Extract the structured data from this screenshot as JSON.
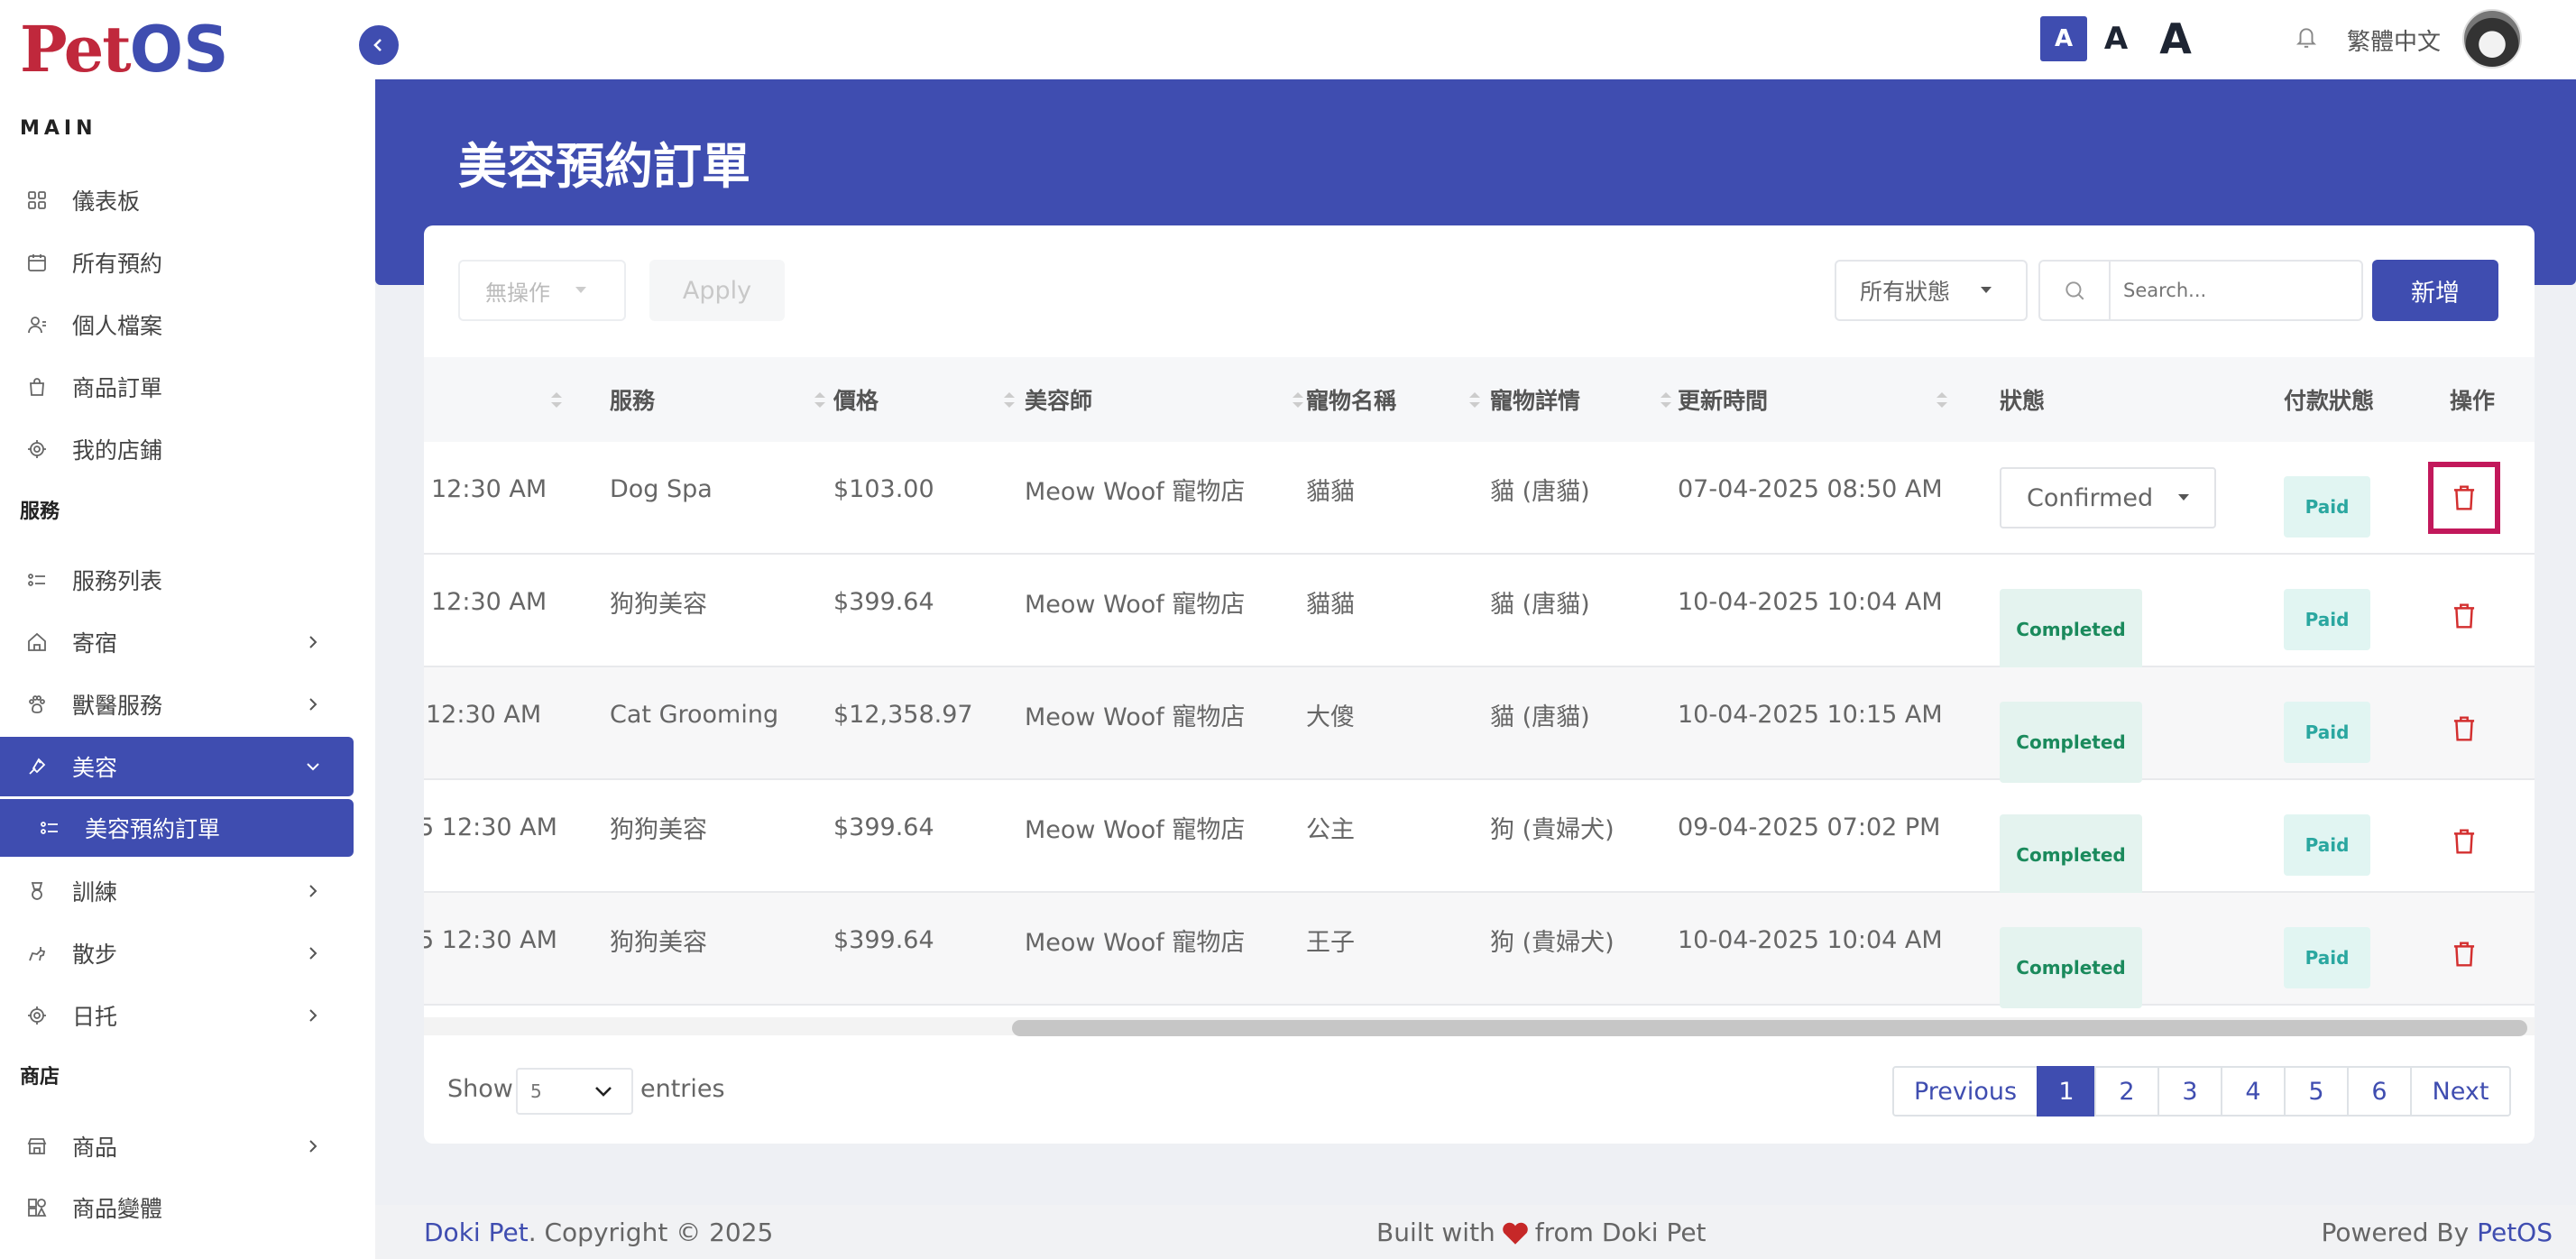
{
  "brand": {
    "logo_pet": "Pet",
    "logo_os": "OS"
  },
  "sidebar": {
    "section_main": "MAIN",
    "section_service": "服務",
    "section_shop": "商店",
    "items": [
      {
        "label": "儀表板"
      },
      {
        "label": "所有預約"
      },
      {
        "label": "個人檔案"
      },
      {
        "label": "商品訂單"
      },
      {
        "label": "我的店鋪"
      },
      {
        "label": "服務列表"
      },
      {
        "label": "寄宿"
      },
      {
        "label": "獸醫服務"
      },
      {
        "label": "美容"
      },
      {
        "label": "美容預約訂單"
      },
      {
        "label": "訓練"
      },
      {
        "label": "散步"
      },
      {
        "label": "日托"
      },
      {
        "label": "商品"
      },
      {
        "label": "商品變體"
      }
    ]
  },
  "topbar": {
    "font_small": "A",
    "font_medium": "A",
    "font_large": "A",
    "language": "繁體中文"
  },
  "page": {
    "title": "美容預約訂單"
  },
  "toolbar": {
    "bulk_action": "無操作",
    "apply": "Apply",
    "status_filter": "所有狀態",
    "search_placeholder": "Search...",
    "add_button": "新增"
  },
  "table": {
    "headers": {
      "service": "服務",
      "price": "價格",
      "groomer": "美容師",
      "pet_name": "寵物名稱",
      "pet_detail": "寵物詳情",
      "updated": "更新時間",
      "status": "狀態",
      "payment": "付款狀態",
      "action": "操作"
    },
    "rows": [
      {
        "time": "12:30 AM",
        "service": "Dog Spa",
        "price": "$103.00",
        "groomer": "Meow Woof 寵物店",
        "pet": "貓貓",
        "detail": "貓 (唐貓)",
        "updated": "07-04-2025 08:50 AM",
        "status": "Confirmed",
        "payment": "Paid"
      },
      {
        "time": "12:30 AM",
        "service": "狗狗美容",
        "price": "$399.64",
        "groomer": "Meow Woof 寵物店",
        "pet": "貓貓",
        "detail": "貓 (唐貓)",
        "updated": "10-04-2025 10:04 AM",
        "status": "Completed",
        "payment": "Paid"
      },
      {
        "time": "12:30 AM",
        "service": "Cat Grooming",
        "price": "$12,358.97",
        "groomer": "Meow Woof 寵物店",
        "pet": "大傻",
        "detail": "貓 (唐貓)",
        "updated": "10-04-2025 10:15 AM",
        "status": "Completed",
        "payment": "Paid"
      },
      {
        "time": "5 12:30 AM",
        "service": "狗狗美容",
        "price": "$399.64",
        "groomer": "Meow Woof 寵物店",
        "pet": "公主",
        "detail": "狗 (貴婦犬)",
        "updated": "09-04-2025 07:02 PM",
        "status": "Completed",
        "payment": "Paid"
      },
      {
        "time": "5 12:30 AM",
        "service": "狗狗美容",
        "price": "$399.64",
        "groomer": "Meow Woof 寵物店",
        "pet": "王子",
        "detail": "狗 (貴婦犬)",
        "updated": "10-04-2025 10:04 AM",
        "status": "Completed",
        "payment": "Paid"
      }
    ]
  },
  "pagination": {
    "show": "Show",
    "entries_value": "5",
    "entries": "entries",
    "previous": "Previous",
    "pages": [
      "1",
      "2",
      "3",
      "4",
      "5",
      "6"
    ],
    "next": "Next"
  },
  "footer": {
    "brand": "Doki Pet",
    "copyright": ". Copyright © 2025",
    "built_pre": "Built with",
    "built_post": "from Doki Pet",
    "powered_pre": "Powered By",
    "powered_brand": "PetOS"
  },
  "colors": {
    "primary": "#3f4db0",
    "brand_red": "#c0283c",
    "danger": "#d32f2f"
  }
}
